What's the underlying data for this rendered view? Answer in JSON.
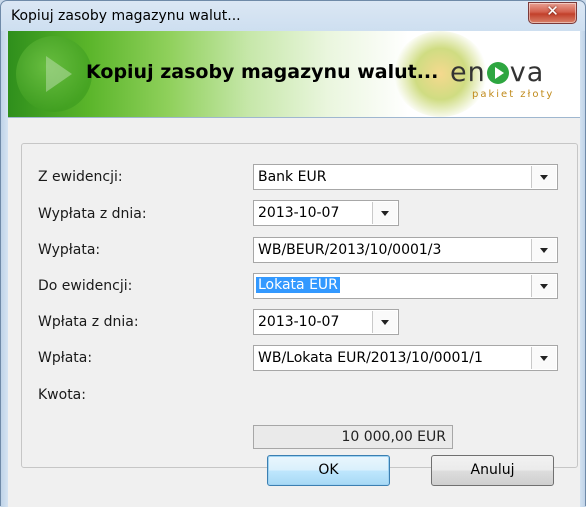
{
  "window": {
    "title": "Kopiuj zasoby magazynu walut...",
    "close_glyph": "✕"
  },
  "banner": {
    "title": "Kopiuj zasoby magazynu walut...",
    "logo_text_left": "en",
    "logo_text_right": "va",
    "logo_subtitle": "pakiet złoty",
    "icons": [
      "play-circle-icon",
      "enova-logo-icon"
    ]
  },
  "form": {
    "z_ewidencji": {
      "label": "Z ewidencji:",
      "value": "Bank EUR"
    },
    "wyplata_z_dnia": {
      "label": "Wypłata z dnia:",
      "value": "2013-10-07"
    },
    "wyplata": {
      "label": "Wypłata:",
      "value": "WB/BEUR/2013/10/0001/3"
    },
    "do_ewidencji": {
      "label": "Do ewidencji:",
      "value": "Lokata EUR"
    },
    "wplata_z_dnia": {
      "label": "Wpłata z dnia:",
      "value": "2013-10-07"
    },
    "wplata": {
      "label": "Wpłata:",
      "value": "WB/Lokata EUR/2013/10/0001/1"
    },
    "kwota": {
      "label": "Kwota:",
      "value": "10 000,00 EUR"
    }
  },
  "buttons": {
    "ok": "OK",
    "cancel": "Anuluj"
  },
  "colors": {
    "selection": "#3399ff",
    "banner_green": "#5ab52a",
    "close_red": "#c2402b"
  }
}
